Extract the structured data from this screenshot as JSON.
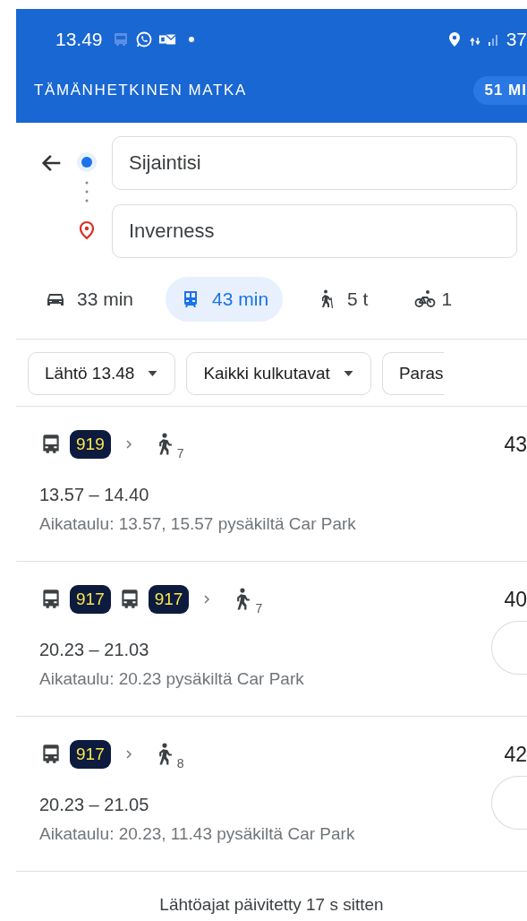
{
  "status_bar": {
    "time": "13.49",
    "battery": "37"
  },
  "header": {
    "title": "TÄMÄNHETKINEN MATKA",
    "badge": "51 MI"
  },
  "search": {
    "origin": "Sijaintisi",
    "destination": "Inverness"
  },
  "modes": [
    {
      "kind": "car",
      "label": "33 min",
      "selected": false
    },
    {
      "kind": "transit",
      "label": "43 min",
      "selected": true
    },
    {
      "kind": "walk",
      "label": "5 t",
      "selected": false
    },
    {
      "kind": "bike",
      "label": "1",
      "selected": false
    }
  ],
  "filters": [
    {
      "label": "Lähtö 13.48",
      "has_menu": true
    },
    {
      "label": "Kaikki kulkutavat",
      "has_menu": true
    },
    {
      "label": "Paras",
      "has_menu": false
    }
  ],
  "routes": [
    {
      "legs": [
        {
          "kind": "bus",
          "line": "919"
        },
        {
          "kind": "walk",
          "minutes": "7"
        }
      ],
      "duration": "43",
      "times": "13.57 – 14.40",
      "schedule": "Aikataulu: 13.57, 15.57 pysäkiltä Car Park",
      "action_button": false
    },
    {
      "legs": [
        {
          "kind": "bus",
          "line": "917"
        },
        {
          "kind": "bus",
          "line": "917"
        },
        {
          "kind": "walk",
          "minutes": "7"
        }
      ],
      "duration": "40",
      "times": "20.23 – 21.03",
      "schedule": "Aikataulu: 20.23 pysäkiltä Car Park",
      "action_button": true
    },
    {
      "legs": [
        {
          "kind": "bus",
          "line": "917"
        },
        {
          "kind": "walk",
          "minutes": "8"
        }
      ],
      "duration": "42",
      "times": "20.23 – 21.05",
      "schedule": "Aikataulu: 20.23, 11.43 pysäkiltä Car Park",
      "action_button": true
    }
  ],
  "footer": "Lähtöajat päivitetty 17 s sitten"
}
